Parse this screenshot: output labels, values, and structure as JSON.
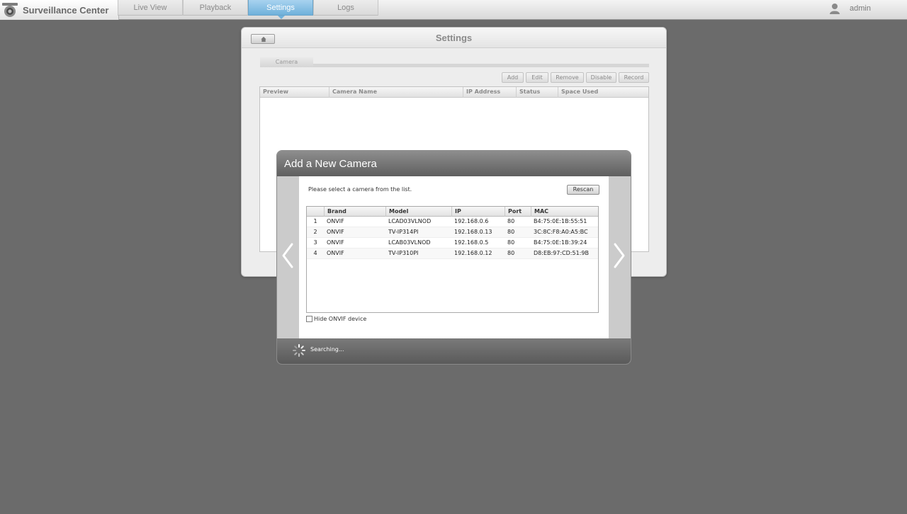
{
  "app": {
    "title": "Surveillance Center",
    "logo_icon": "camera-icon"
  },
  "nav": {
    "tabs": [
      {
        "label": "Live View",
        "active": false
      },
      {
        "label": "Playback",
        "active": false
      },
      {
        "label": "Settings",
        "active": true
      },
      {
        "label": "Logs",
        "active": false
      }
    ]
  },
  "user": {
    "name": "admin",
    "icon": "user-icon"
  },
  "settings": {
    "title": "Settings",
    "home_icon": "home-icon",
    "subtab": "Camera",
    "toolbar": {
      "add": "Add",
      "edit": "Edit",
      "remove": "Remove",
      "disable": "Disable",
      "record": "Record"
    },
    "columns": [
      "Preview",
      "Camera Name",
      "IP Address",
      "Status",
      "Space Used"
    ]
  },
  "modal": {
    "title": "Add a New Camera",
    "instruction": "Please select a camera from the list.",
    "rescan": "Rescan",
    "columns": {
      "brand": "Brand",
      "model": "Model",
      "ip": "IP",
      "port": "Port",
      "mac": "MAC"
    },
    "rows": [
      {
        "num": "1",
        "brand": "ONVIF",
        "model": "LCAD03VLNOD",
        "ip": "192.168.0.6",
        "port": "80",
        "mac": "B4:75:0E:1B:55:51"
      },
      {
        "num": "2",
        "brand": "ONVIF",
        "model": "TV-IP314PI",
        "ip": "192.168.0.13",
        "port": "80",
        "mac": "3C:8C:F8:A0:A5:BC"
      },
      {
        "num": "3",
        "brand": "ONVIF",
        "model": "LCAB03VLNOD",
        "ip": "192.168.0.5",
        "port": "80",
        "mac": "B4:75:0E:1B:39:24"
      },
      {
        "num": "4",
        "brand": "ONVIF",
        "model": "TV-IP310PI",
        "ip": "192.168.0.12",
        "port": "80",
        "mac": "D8:EB:97:CD:51:9B"
      }
    ],
    "hide_onvif": {
      "label": "Hide ONVIF device",
      "checked": false
    },
    "status": "Searching...",
    "prev_icon": "chevron-left-icon",
    "next_icon": "chevron-right-icon",
    "spinner_icon": "spinner-icon"
  },
  "colors": {
    "accent": "#6fb1db",
    "background": "#6b6b6b",
    "modal_header": "#5f5f5f"
  }
}
